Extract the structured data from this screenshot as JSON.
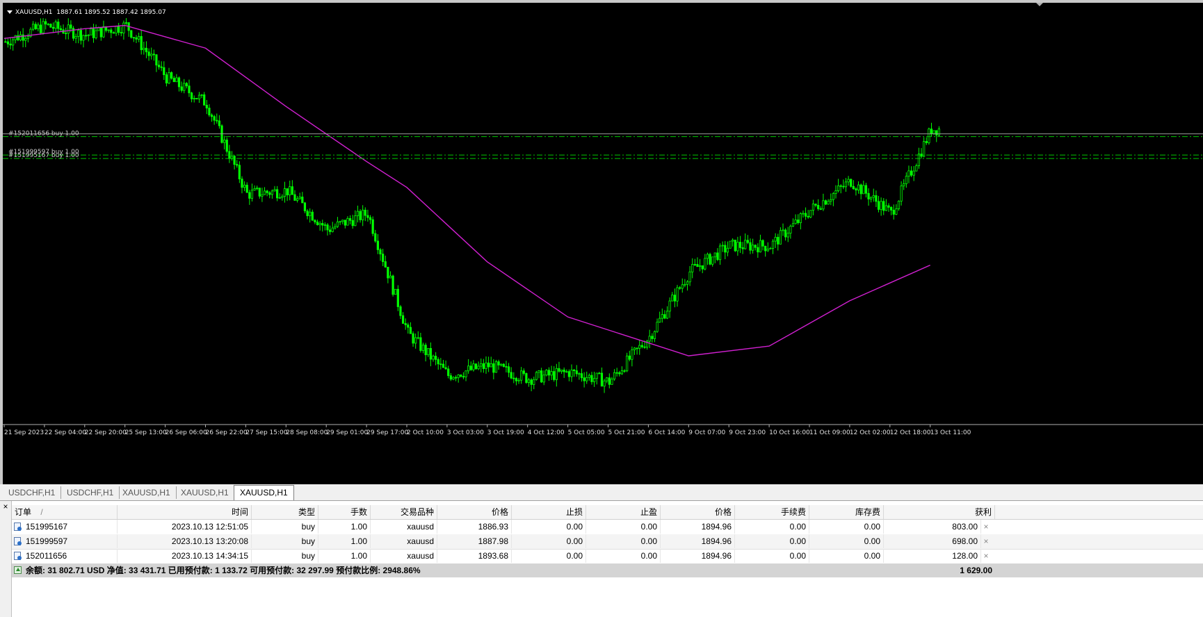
{
  "chart": {
    "symbol_info": "XAUUSD,H1  1887.61 1895.52 1887.42 1895.07",
    "x_labels": [
      "21 Sep 2023",
      "22 Sep 04:00",
      "22 Sep 20:00",
      "25 Sep 13:00",
      "26 Sep 06:00",
      "26 Sep 22:00",
      "27 Sep 15:00",
      "28 Sep 08:00",
      "29 Sep 01:00",
      "29 Sep 17:00",
      "2 Oct 10:00",
      "3 Oct 03:00",
      "3 Oct 19:00",
      "4 Oct 12:00",
      "5 Oct 05:00",
      "5 Oct 21:00",
      "6 Oct 14:00",
      "9 Oct 07:00",
      "9 Oct 23:00",
      "10 Oct 16:00",
      "11 Oct 09:00",
      "12 Oct 02:00",
      "12 Oct 18:00",
      "13 Oct 11:00"
    ],
    "order_labels": [
      "#152011656 buy 1.00",
      "#151999597 buy 1.00",
      "#151995167 buy 1.00"
    ],
    "colors": {
      "background": "#000000",
      "candle": "#00ff00",
      "ma": "#d020d0",
      "order_line": "#00c800",
      "grid": "#9a9a9a"
    }
  },
  "chart_data": {
    "type": "candlestick",
    "price_path_keypoints": [
      {
        "x": "21 Sep 2023",
        "y": 1923
      },
      {
        "x": "22 Sep 04:00",
        "y": 1928
      },
      {
        "x": "22 Sep 20:00",
        "y": 1925
      },
      {
        "x": "25 Sep 13:00",
        "y": 1928
      },
      {
        "x": "26 Sep 06:00",
        "y": 1912
      },
      {
        "x": "26 Sep 22:00",
        "y": 1904
      },
      {
        "x": "27 Sep 15:00",
        "y": 1876
      },
      {
        "x": "28 Sep 08:00",
        "y": 1877
      },
      {
        "x": "29 Sep 01:00",
        "y": 1865
      },
      {
        "x": "29 Sep 17:00",
        "y": 1870
      },
      {
        "x": "2 Oct 10:00",
        "y": 1833
      },
      {
        "x": "3 Oct 03:00",
        "y": 1820
      },
      {
        "x": "3 Oct 19:00",
        "y": 1823
      },
      {
        "x": "4 Oct 12:00",
        "y": 1819
      },
      {
        "x": "5 Oct 05:00",
        "y": 1821
      },
      {
        "x": "5 Oct 21:00",
        "y": 1818
      },
      {
        "x": "6 Oct 14:00",
        "y": 1832
      },
      {
        "x": "9 Oct 07:00",
        "y": 1852
      },
      {
        "x": "9 Oct 23:00",
        "y": 1860
      },
      {
        "x": "10 Oct 16:00",
        "y": 1860
      },
      {
        "x": "11 Oct 09:00",
        "y": 1871
      },
      {
        "x": "12 Oct 02:00",
        "y": 1880
      },
      {
        "x": "12 Oct 18:00",
        "y": 1870
      },
      {
        "x": "13 Oct 11:00",
        "y": 1896
      }
    ],
    "ma_keypoints": [
      {
        "x": "21 Sep 2023",
        "y": 1924
      },
      {
        "x": "22 Sep 20:00",
        "y": 1927
      },
      {
        "x": "25 Sep 13:00",
        "y": 1928
      },
      {
        "x": "26 Sep 22:00",
        "y": 1921
      },
      {
        "x": "28 Sep 08:00",
        "y": 1903
      },
      {
        "x": "29 Sep 17:00",
        "y": 1886
      },
      {
        "x": "2 Oct 10:00",
        "y": 1878
      },
      {
        "x": "3 Oct 19:00",
        "y": 1855
      },
      {
        "x": "5 Oct 05:00",
        "y": 1838
      },
      {
        "x": "6 Oct 14:00",
        "y": 1830
      },
      {
        "x": "9 Oct 07:00",
        "y": 1826
      },
      {
        "x": "10 Oct 16:00",
        "y": 1829
      },
      {
        "x": "12 Oct 02:00",
        "y": 1843
      },
      {
        "x": "13 Oct 11:00",
        "y": 1854
      }
    ],
    "order_levels": [
      1893.68,
      1887.98,
      1886.93
    ],
    "ylim": [
      1805,
      1935
    ]
  },
  "tabs": [
    {
      "label": "USDCHF,H1"
    },
    {
      "label": "USDCHF,H1"
    },
    {
      "label": "XAUUSD,H1"
    },
    {
      "label": "XAUUSD,H1"
    },
    {
      "label": "XAUUSD,H1"
    }
  ],
  "terminal": {
    "headers": {
      "order": "订单",
      "sort": "/",
      "time": "时间",
      "type": "类型",
      "lots": "手数",
      "symbol": "交易品种",
      "price": "价格",
      "sl": "止损",
      "tp": "止盈",
      "cur_price": "价格",
      "commission": "手续费",
      "swap": "库存费",
      "profit": "获利"
    },
    "rows": [
      {
        "order": "151995167",
        "time": "2023.10.13 12:51:05",
        "type": "buy",
        "lots": "1.00",
        "symbol": "xauusd",
        "price": "1886.93",
        "sl": "0.00",
        "tp": "0.00",
        "cur_price": "1894.96",
        "commission": "0.00",
        "swap": "0.00",
        "profit": "803.00"
      },
      {
        "order": "151999597",
        "time": "2023.10.13 13:20:08",
        "type": "buy",
        "lots": "1.00",
        "symbol": "xauusd",
        "price": "1887.98",
        "sl": "0.00",
        "tp": "0.00",
        "cur_price": "1894.96",
        "commission": "0.00",
        "swap": "0.00",
        "profit": "698.00"
      },
      {
        "order": "152011656",
        "time": "2023.10.13 14:34:15",
        "type": "buy",
        "lots": "1.00",
        "symbol": "xauusd",
        "price": "1893.68",
        "sl": "0.00",
        "tp": "0.00",
        "cur_price": "1894.96",
        "commission": "0.00",
        "swap": "0.00",
        "profit": "128.00"
      }
    ],
    "summary": {
      "text": "余额: 31 802.71 USD  净值: 33 431.71  已用预付款: 1 133.72  可用预付款: 32 297.99  预付款比例: 2948.86%",
      "total": "1 629.00"
    },
    "close_glyph": "×",
    "panel_close": "×"
  }
}
